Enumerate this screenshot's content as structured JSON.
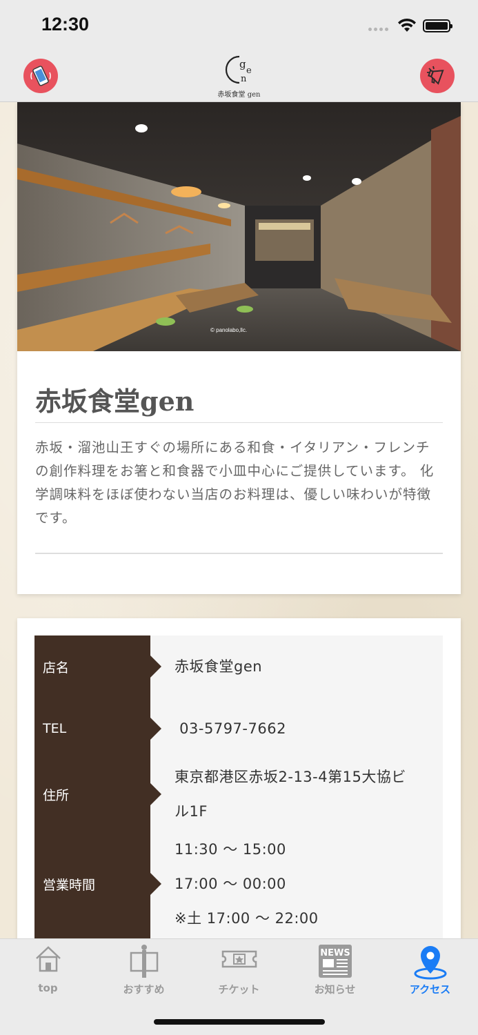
{
  "status_bar": {
    "time": "12:30"
  },
  "header": {
    "logo_text": "赤坂食堂 gen",
    "left_button_icon": "phone-icon",
    "right_button_icon": "megaphone-icon",
    "accent_color": "#e8525e"
  },
  "hero": {
    "photo_credit": "© panolabo,llc.",
    "title": "赤坂食堂gen",
    "description": "赤坂・溜池山王すぐの場所にある和食・イタリアン・フレンチの創作料理をお箸と和食器で小皿中心にご提供しています。 化学調味料をほぼ使わない当店のお料理は、優しい味わいが特徴です。"
  },
  "info": {
    "rows": [
      {
        "label": "店名",
        "lines": [
          "赤坂食堂gen"
        ]
      },
      {
        "label": "TEL",
        "lines": [
          " 03-5797-7662"
        ]
      },
      {
        "label": "住所",
        "lines": [
          "東京都港区赤坂2-13-4第15大協ビ",
          "ル1F"
        ]
      },
      {
        "label": "営業時間",
        "lines": [
          "11:30 〜 15:00",
          "17:00 〜 00:00",
          "※土 17:00 〜 22:00"
        ]
      }
    ],
    "label_bg_color": "#422f24"
  },
  "tab_bar": {
    "tabs": [
      {
        "label": "top",
        "icon": "home-icon",
        "active": false
      },
      {
        "label": "おすすめ",
        "icon": "signboard-icon",
        "active": false
      },
      {
        "label": "チケット",
        "icon": "ticket-icon",
        "active": false
      },
      {
        "label": "お知らせ",
        "icon": "news-icon",
        "active": false
      },
      {
        "label": "アクセス",
        "icon": "location-pin-icon",
        "active": true
      }
    ],
    "active_color": "#1a7cf5"
  }
}
